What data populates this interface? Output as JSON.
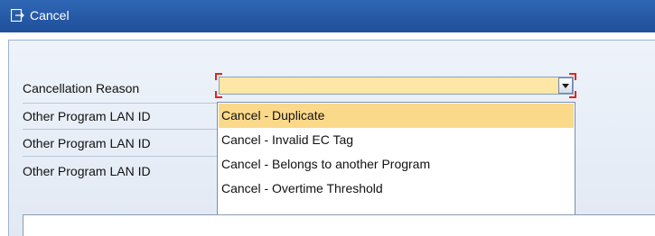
{
  "window": {
    "title": "Cancel",
    "icon": "exit-doc-icon"
  },
  "form": {
    "fields": [
      {
        "label": "Cancellation Reason"
      },
      {
        "label": "Other Program LAN ID"
      },
      {
        "label": "Other Program LAN ID"
      },
      {
        "label": "Other Program LAN ID"
      }
    ],
    "cancellation_reason": {
      "value": "",
      "dropdown_icon": "chevron-down-icon"
    }
  },
  "dropdown": {
    "options": [
      {
        "label": "Cancel - Duplicate",
        "selected": true
      },
      {
        "label": "Cancel - Invalid EC Tag",
        "selected": false
      },
      {
        "label": "Cancel - Belongs to another Program",
        "selected": false
      },
      {
        "label": "Cancel - Overtime Threshold",
        "selected": false
      }
    ]
  },
  "colors": {
    "title_bar": "#2f67b5",
    "field_bg": "#fde7a6",
    "highlight": "#fbd98a",
    "required_marker": "#e0251b"
  }
}
